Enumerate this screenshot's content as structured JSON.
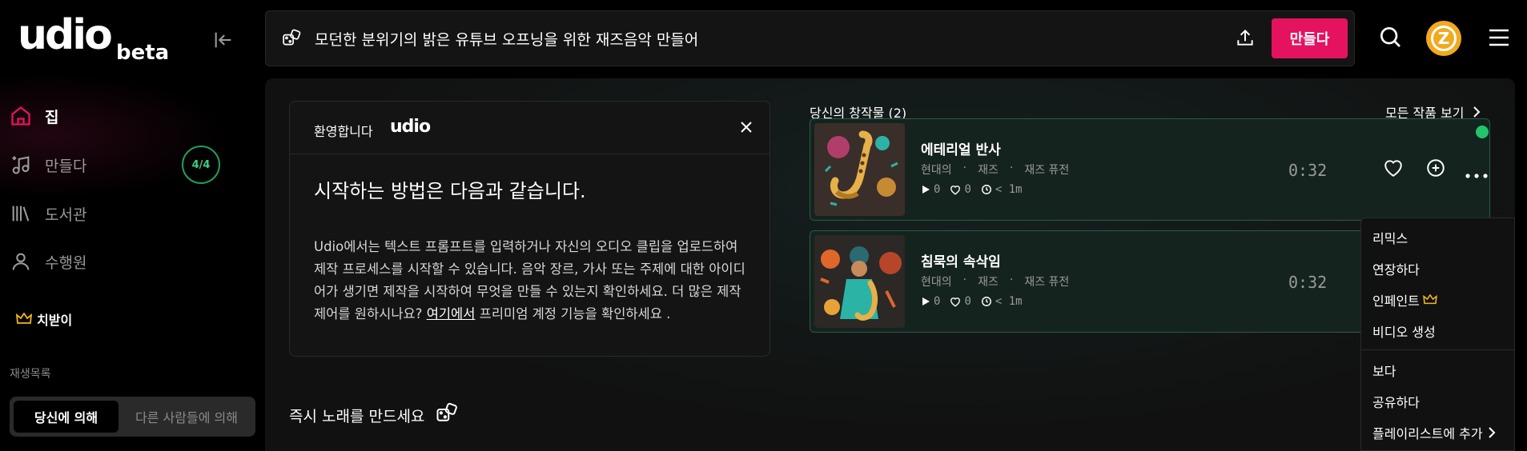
{
  "sidebar": {
    "logo": "udio",
    "beta": "beta",
    "nav": [
      {
        "label": "집"
      },
      {
        "label": "만들다",
        "badge": "4/4"
      },
      {
        "label": "도서관"
      },
      {
        "label": "수행원"
      }
    ],
    "rewards": "치받이",
    "playlist_heading": "재생목록",
    "segment": {
      "by_you": "당신에 의해",
      "by_others": "다른 사람들에 의해"
    }
  },
  "topbar": {
    "prompt": "모던한 분위기의 밝은 유튜브 오프닝을 위한 재즈음악 만들어",
    "make_button": "만들다",
    "avatar_letter": "Z"
  },
  "welcome": {
    "title": "환영합니다",
    "brand": "udio",
    "heading": "시작하는 방법은 다음과 같습니다.",
    "body_before": "Udio에서는 텍스트 프롬프트를 입력하거나 자신의 오디오 클립을 업로드하여 제작 프로세스를 시작할 수 있습니다. 음악 장르, 가사 또는 주제에 대한 아이디어가 생기면 제작을 시작하여 무엇을 만들 수 있는지 확인하세요. 더 많은 제작 제어를 원하시나요? ",
    "body_link": "여기에서",
    "body_after": " 프리미엄 계정 기능을 확인하세요 ."
  },
  "instant": {
    "label": "즉시 노래를 만드세요"
  },
  "creations": {
    "heading": "당신의 창작물 (2)",
    "view_all": "모든 작품 보기",
    "tracks": [
      {
        "title": "에테리얼 반사",
        "tags": [
          "현대의",
          "·",
          "재즈",
          "·",
          "재즈 퓨전"
        ],
        "plays": "0",
        "likes": "0",
        "age": "< 1m",
        "duration": "0:32"
      },
      {
        "title": "침묵의 속삭임",
        "tags": [
          "현대의",
          "·",
          "재즈",
          "·",
          "재즈 퓨전"
        ],
        "plays": "0",
        "likes": "0",
        "age": "< 1m",
        "duration": "0:32"
      }
    ]
  },
  "context_menu": {
    "items": [
      "리믹스",
      "연장하다",
      "인페인트",
      "비디오 생성",
      "보다",
      "공유하다",
      "플레이리스트에 추가"
    ]
  },
  "colors": {
    "accent": "#e4125f",
    "success": "#23c46a",
    "crown": "#f2b61f"
  }
}
